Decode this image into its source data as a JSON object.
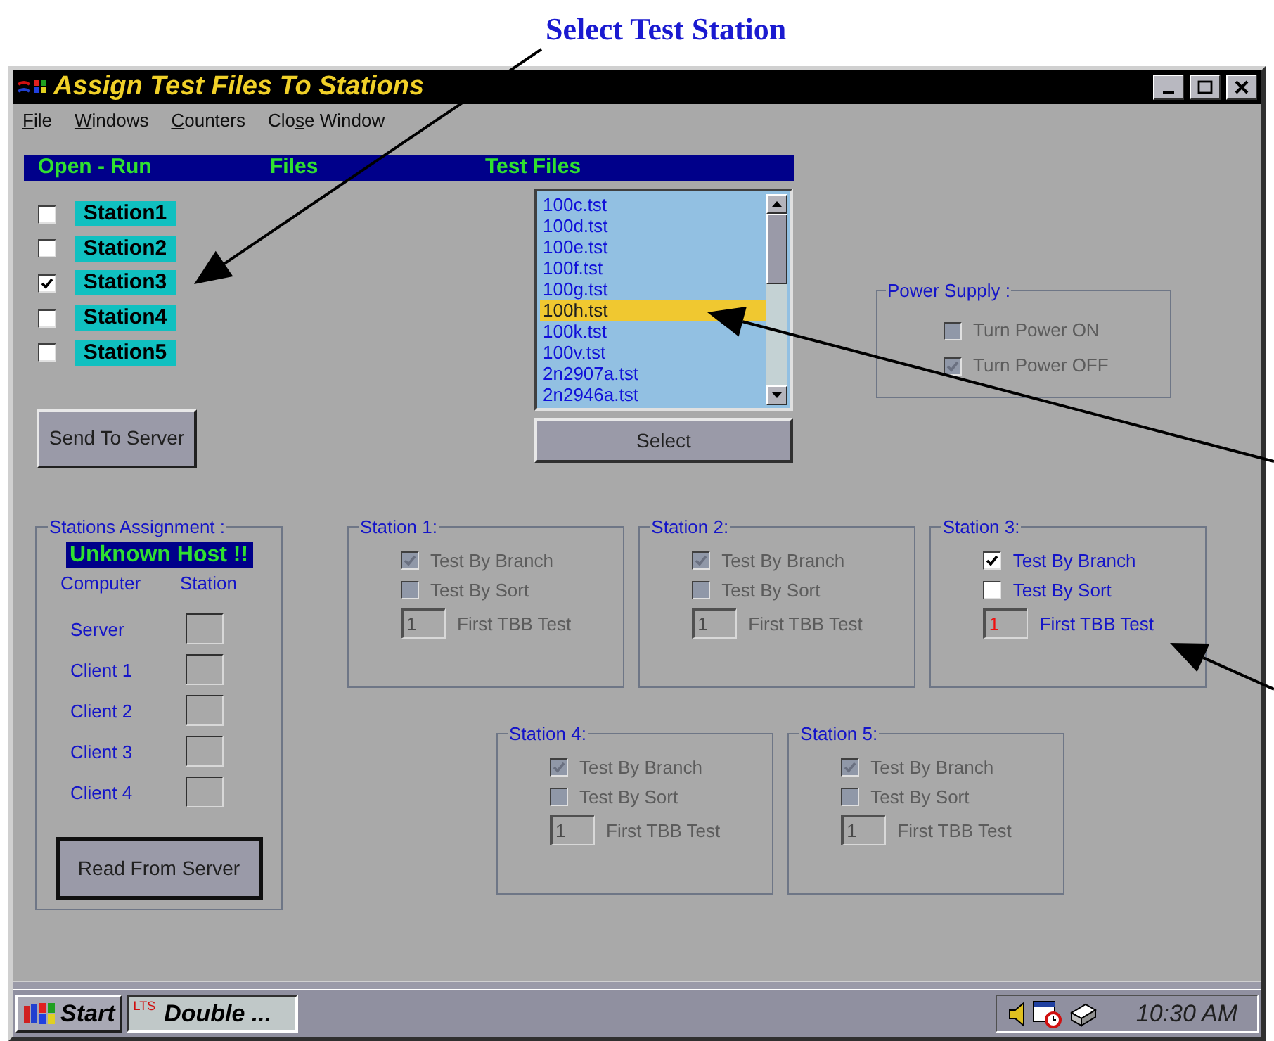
{
  "annotation": {
    "text": "Select Test Station"
  },
  "window": {
    "title": "Assign Test Files To Stations"
  },
  "menu": [
    {
      "key": "F",
      "post": "ile"
    },
    {
      "key": "W",
      "post": "indows"
    },
    {
      "key": "C",
      "post": "ounters"
    },
    {
      "pre": "Clo",
      "key": "s",
      "post": "e Window"
    }
  ],
  "header_bar": {
    "columns": [
      "Open - Run",
      "Files",
      "Test Files"
    ]
  },
  "stations": [
    {
      "label": "Station1",
      "checked": false
    },
    {
      "label": "Station2",
      "checked": false
    },
    {
      "label": "Station3",
      "checked": true
    },
    {
      "label": "Station4",
      "checked": false
    },
    {
      "label": "Station5",
      "checked": false
    }
  ],
  "send_button": "Send To Server",
  "test_files": {
    "items": [
      {
        "name": "100c.tst",
        "selected": false
      },
      {
        "name": "100d.tst",
        "selected": false
      },
      {
        "name": "100e.tst",
        "selected": false
      },
      {
        "name": "100f.tst",
        "selected": false
      },
      {
        "name": "100g.tst",
        "selected": false
      },
      {
        "name": "100h.tst",
        "selected": true
      },
      {
        "name": "100k.tst",
        "selected": false
      },
      {
        "name": "100v.tst",
        "selected": false
      },
      {
        "name": "2n2907a.tst",
        "selected": false
      },
      {
        "name": "2n2946a.tst",
        "selected": false
      }
    ],
    "select_button": "Select"
  },
  "power_supply": {
    "title": "Power Supply :",
    "disabled": true,
    "options": [
      {
        "label": "Turn Power ON",
        "checked": false
      },
      {
        "label": "Turn Power OFF",
        "checked": true
      }
    ]
  },
  "stations_assignment": {
    "title": "Stations Assignment :",
    "status": "Unknown Host !!",
    "columns": [
      "Computer",
      "Station"
    ],
    "rows": [
      {
        "computer": "Server"
      },
      {
        "computer": "Client 1"
      },
      {
        "computer": "Client 2"
      },
      {
        "computer": "Client 3"
      },
      {
        "computer": "Client 4"
      }
    ],
    "read_button": "Read From Server"
  },
  "station_groups": [
    {
      "title": "Station 1:",
      "disabled": true,
      "options": [
        {
          "label": "Test By Branch",
          "checked": true
        },
        {
          "label": "Test By Sort",
          "checked": false
        }
      ],
      "first_tbb": {
        "value": "1",
        "label": "First TBB Test"
      }
    },
    {
      "title": "Station 2:",
      "disabled": true,
      "options": [
        {
          "label": "Test By Branch",
          "checked": true
        },
        {
          "label": "Test By Sort",
          "checked": false
        }
      ],
      "first_tbb": {
        "value": "1",
        "label": "First TBB Test"
      }
    },
    {
      "title": "Station 3:",
      "disabled": false,
      "options": [
        {
          "label": "Test By Branch",
          "checked": true
        },
        {
          "label": "Test By Sort",
          "checked": false
        }
      ],
      "first_tbb": {
        "value": "1",
        "label": "First TBB Test"
      }
    },
    {
      "title": "Station 4:",
      "disabled": true,
      "options": [
        {
          "label": "Test By Branch",
          "checked": true
        },
        {
          "label": "Test By Sort",
          "checked": false
        }
      ],
      "first_tbb": {
        "value": "1",
        "label": "First TBB Test"
      }
    },
    {
      "title": "Station 5:",
      "disabled": true,
      "options": [
        {
          "label": "Test By Branch",
          "checked": true
        },
        {
          "label": "Test By Sort",
          "checked": false
        }
      ],
      "first_tbb": {
        "value": "1",
        "label": "First TBB Test"
      }
    }
  ],
  "taskbar": {
    "start": "Start",
    "task_badge": "LTS",
    "task": "Double ...",
    "clock": "10:30 AM"
  }
}
